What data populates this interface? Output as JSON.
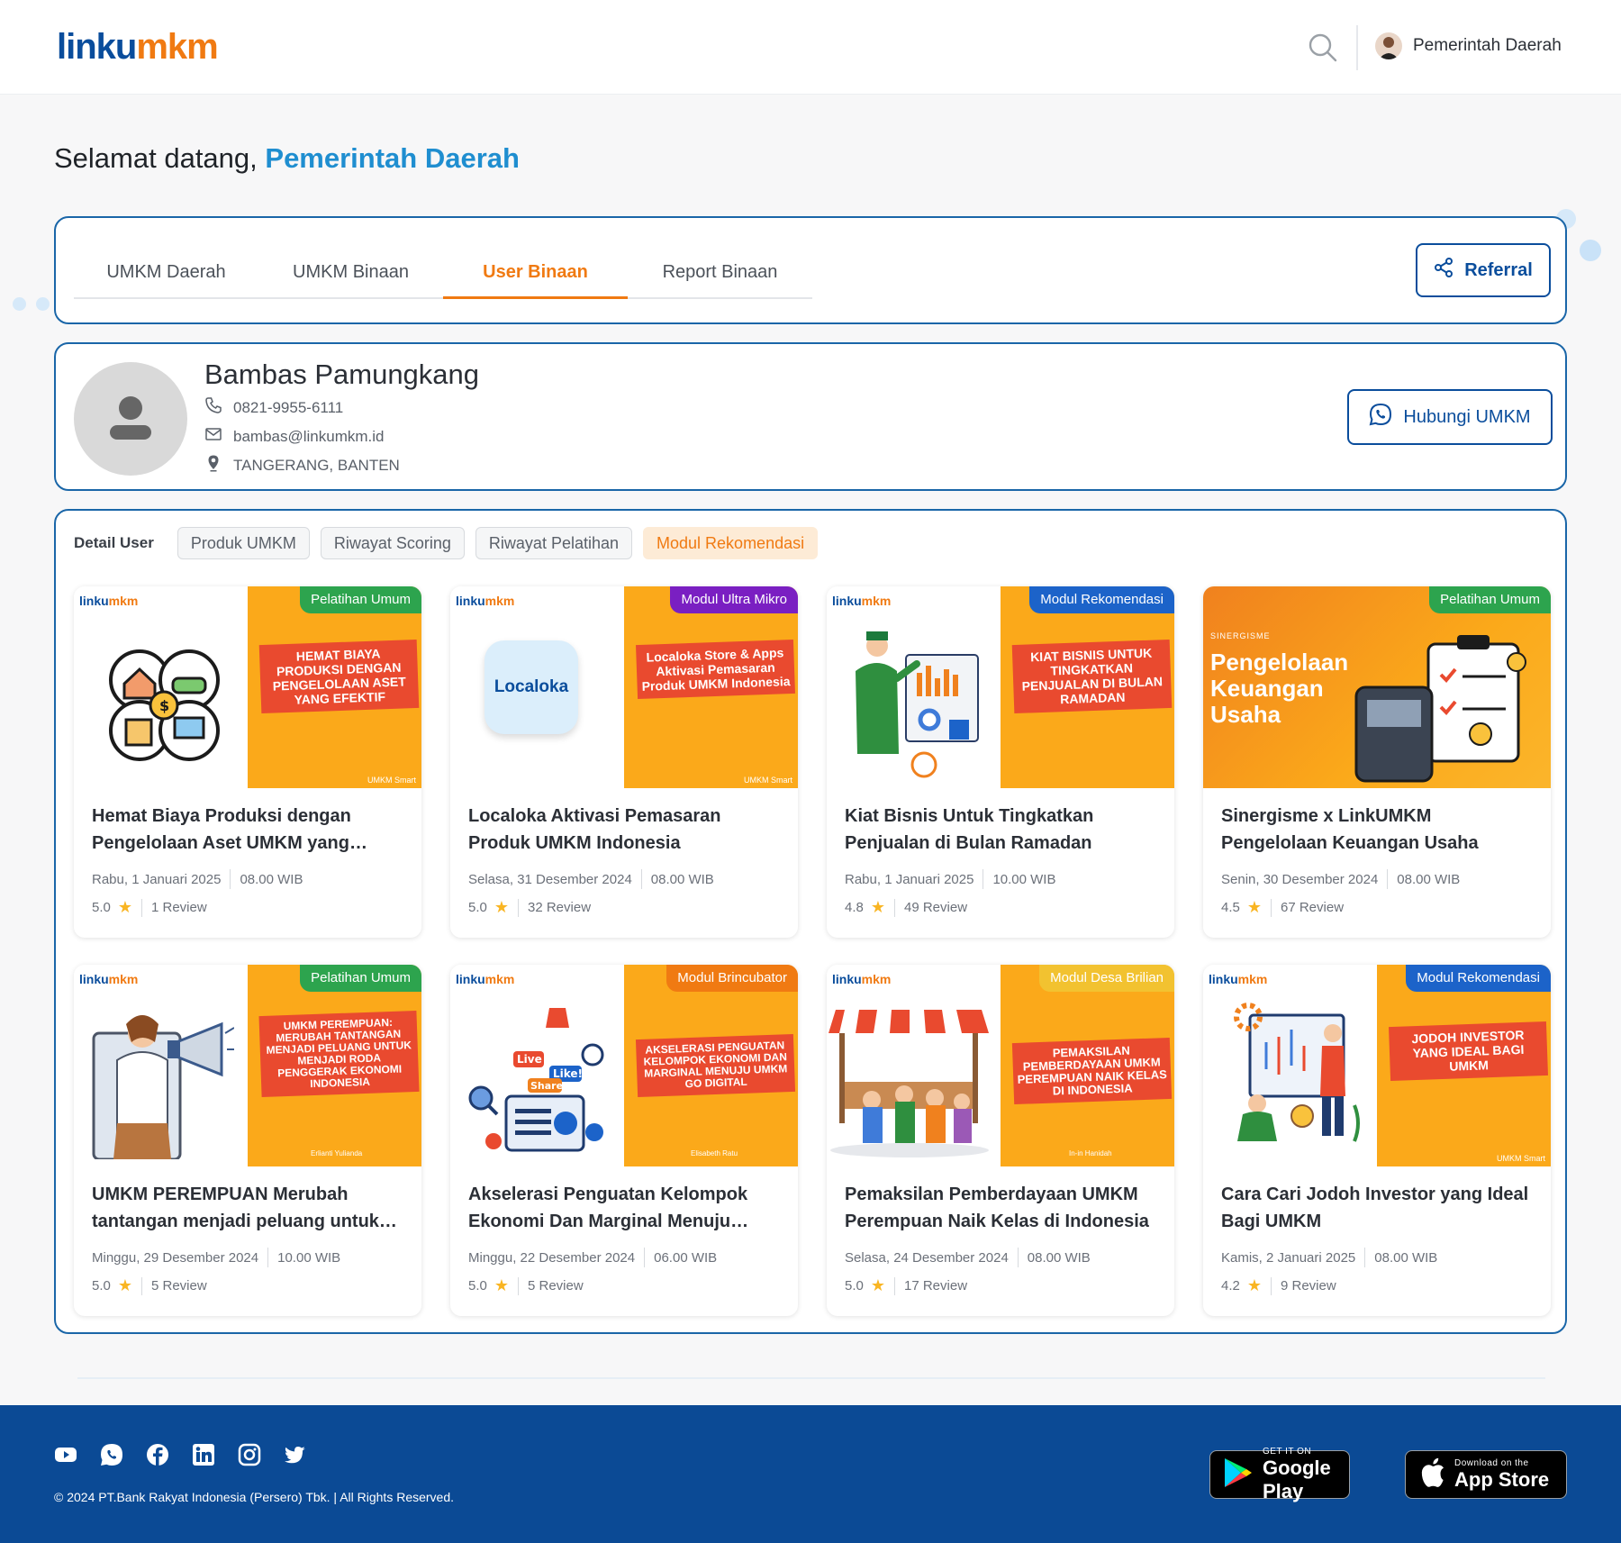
{
  "brand": {
    "logo_left": "linku",
    "logo_right": "mkm"
  },
  "header": {
    "user_name": "Pemerintah Daerah"
  },
  "welcome": {
    "prefix": "Selamat datang, ",
    "name": "Pemerintah Daerah"
  },
  "tabs": [
    {
      "label": "UMKM Daerah"
    },
    {
      "label": "UMKM Binaan"
    },
    {
      "label": "User Binaan"
    },
    {
      "label": "Report Binaan"
    }
  ],
  "referral_label": "Referral",
  "profile": {
    "name": "Bambas Pamungkang",
    "phone": "0821-9955-6111",
    "email": "bambas@linkumkm.id",
    "location": "TANGERANG, BANTEN",
    "contact_label": "Hubungi UMKM"
  },
  "subtabs": {
    "lead": "Detail User",
    "items": [
      {
        "label": "Produk UMKM"
      },
      {
        "label": "Riwayat Scoring"
      },
      {
        "label": "Riwayat Pelatihan"
      },
      {
        "label": "Modul Rekomendasi"
      }
    ]
  },
  "colors": {
    "primary": "#0a4d9c",
    "accent": "#f07a12",
    "badge_green": "#2da44e",
    "badge_purple": "#7a1fc2",
    "badge_blue": "#1c63c9",
    "badge_orange": "#f07a12",
    "badge_yellow": "#f2c230"
  },
  "cards": [
    {
      "badge": "Pelatihan Umum",
      "thumb_text": "HEMAT BIAYA PRODUKSI DENGAN PENGELOLAAN ASET YANG EFEKTIF",
      "thumb_sub": "UMKM Smart",
      "title": "Hemat Biaya Produksi dengan Pengelolaan Aset UMKM yang Efektif",
      "date": "Rabu, 1 Januari 2025",
      "time": "08.00 WIB",
      "rating": "5.0",
      "reviews": "1 Review"
    },
    {
      "badge": "Modul Ultra Mikro",
      "thumb_text": "Localoka Store & Apps Aktivasi Pemasaran Produk UMKM Indonesia",
      "thumb_sub": "UMKM Smart",
      "art_text": "Localoka",
      "title": "Localoka Aktivasi Pemasaran Produk UMKM Indonesia",
      "date": "Selasa, 31 Desember 2024",
      "time": "08.00 WIB",
      "rating": "5.0",
      "reviews": "32 Review"
    },
    {
      "badge": "Modul Rekomendasi",
      "thumb_text": "KIAT BISNIS UNTUK TINGKATKAN PENJUALAN DI BULAN RAMADAN",
      "thumb_sub": "",
      "title": "Kiat Bisnis Untuk Tingkatkan Penjualan di Bulan Ramadan",
      "date": "Rabu, 1 Januari 2025",
      "time": "10.00 WIB",
      "rating": "4.8",
      "reviews": "49 Review"
    },
    {
      "badge": "Pelatihan Umum",
      "thumb_text": "Pengelolaan Keuangan Usaha",
      "thumb_sub": "SINERGISME",
      "title": "Sinergisme x LinkUMKM Pengelolaan Keuangan Usaha",
      "date": "Senin, 30 Desember 2024",
      "time": "08.00 WIB",
      "rating": "4.5",
      "reviews": "67 Review"
    },
    {
      "badge": "Pelatihan Umum",
      "thumb_text": "UMKM PEREMPUAN: MERUBAH TANTANGAN MENJADI PELUANG UNTUK MENJADI RODA PENGGERAK EKONOMI INDONESIA",
      "thumb_sub": "Erlianti Yulianda",
      "title": "UMKM PEREMPUAN Merubah tantangan menjadi peluang untuk menjadi roda penggerak ekonomi Indonesia",
      "date": "Minggu, 29 Desember 2024",
      "time": "10.00 WIB",
      "rating": "5.0",
      "reviews": "5 Review"
    },
    {
      "badge": "Modul Brincubator",
      "thumb_text": "AKSELERASI PENGUATAN KELOMPOK EKONOMI DAN MARGINAL MENUJU UMKM GO DIGITAL",
      "thumb_sub": "Elisabeth Ratu",
      "art_text": "Live",
      "art_text2": "Like!",
      "art_text3": "Share",
      "title": "Akselerasi Penguatan Kelompok Ekonomi Dan Marginal Menuju UMKM Go Digital",
      "date": "Minggu, 22 Desember 2024",
      "time": "06.00 WIB",
      "rating": "5.0",
      "reviews": "5 Review"
    },
    {
      "badge": "Modul Desa Brilian",
      "thumb_text": "PEMAKSILAN PEMBERDAYAAN UMKM PEREMPUAN NAIK KELAS DI INDONESIA",
      "thumb_sub": "In-in Hanidah",
      "title": "Pemaksilan Pemberdayaan UMKM Perempuan Naik Kelas di Indonesia",
      "date": "Selasa, 24 Desember 2024",
      "time": "08.00 WIB",
      "rating": "5.0",
      "reviews": "17 Review"
    },
    {
      "badge": "Modul Rekomendasi",
      "thumb_text": "JODOH INVESTOR YANG IDEAL BAGI UMKM",
      "thumb_sub": "UMKM Smart",
      "title": "Cara Cari Jodoh Investor yang Ideal Bagi UMKM",
      "date": "Kamis, 2 Januari 2025",
      "time": "08.00 WIB",
      "rating": "4.2",
      "reviews": "9 Review"
    }
  ],
  "footer": {
    "copyright": "© 2024 PT.Bank Rakyat Indonesia (Persero) Tbk. | All Rights Reserved.",
    "google_small": "GET IT ON",
    "google_big": "Google Play",
    "apple_small": "Download on the",
    "apple_big": "App Store"
  }
}
